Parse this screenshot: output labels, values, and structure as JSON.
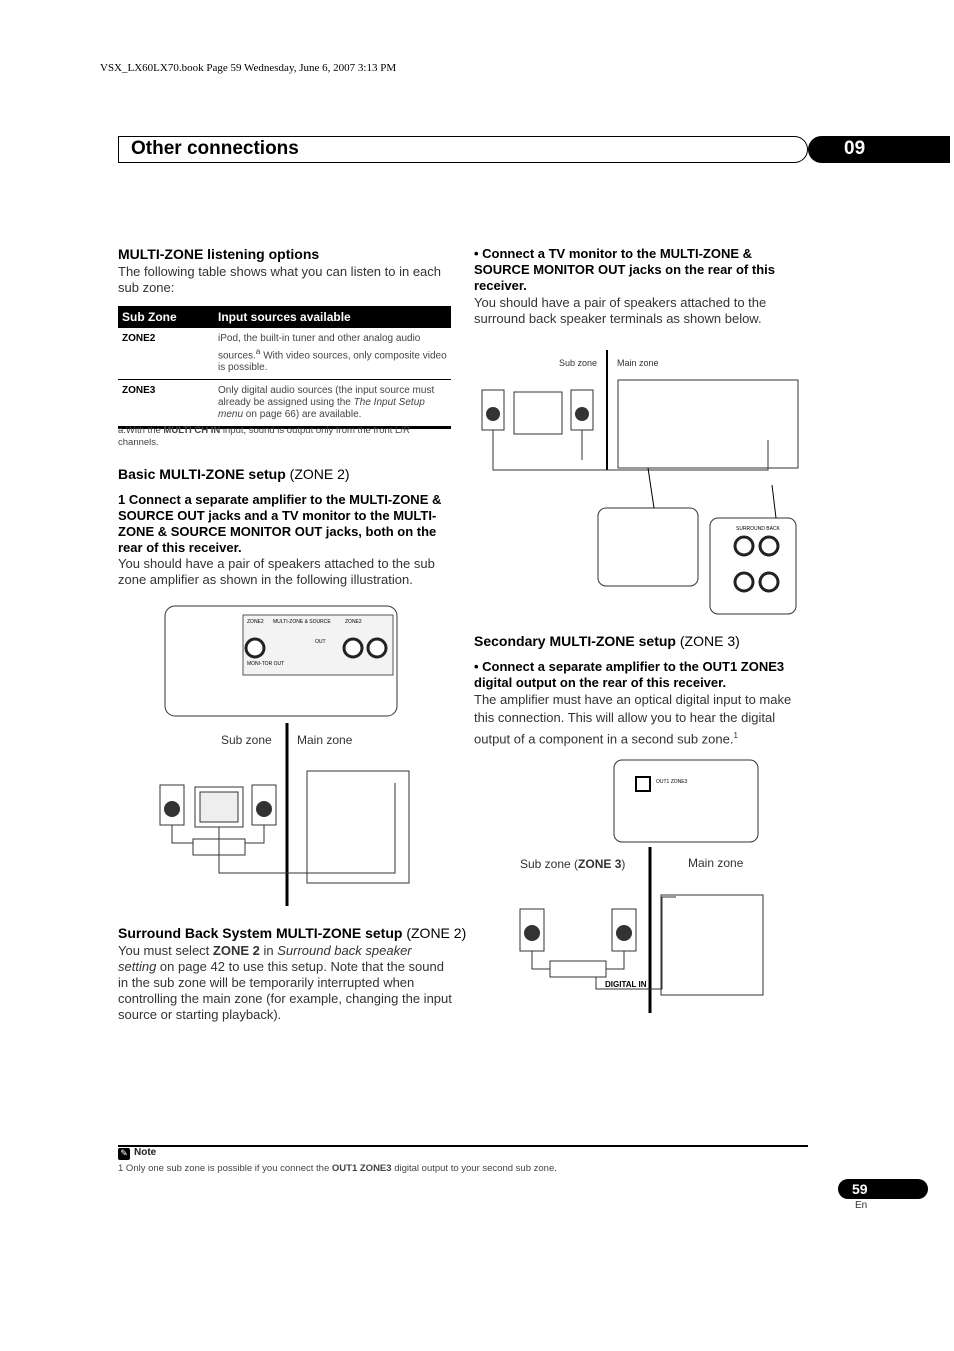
{
  "book_line": "VSX_LX60LX70.book  Page 59  Wednesday, June 6, 2007  3:13 PM",
  "header": {
    "title": "Other connections",
    "chapter": "09"
  },
  "left": {
    "h1": "MULTI-ZONE listening options",
    "intro": "The following table shows what you can listen to in each sub zone:",
    "table": {
      "headers": [
        "Sub Zone",
        "Input sources available"
      ],
      "rows": [
        {
          "zone": "ZONE2",
          "text": "iPod, the built-in tuner and other analog audio sources.",
          "sup": "a",
          "text2": " With video sources, only composite video is possible."
        },
        {
          "zone": "ZONE3",
          "text": "Only digital audio sources (the input source must already be assigned using the ",
          "italic": "The Input Setup menu",
          "text2": " on page 66) are available."
        }
      ]
    },
    "footnote": {
      "prefix": "a.With the ",
      "bold": "MULTI CH IN",
      "rest": " input, sound is output only from the front L/R channels."
    },
    "h2": "Basic MULTI-ZONE setup",
    "h2_paren": "(ZONE 2)",
    "step1": "1   Connect a separate amplifier to the MULTI-ZONE & SOURCE OUT jacks and a TV monitor to the MULTI-ZONE & SOURCE MONITOR OUT jacks, both on the rear of this receiver.",
    "step1_body": "You should have a pair of speakers attached to the sub zone amplifier as shown in the following illustration.",
    "diagram1": {
      "sub_zone": "Sub zone",
      "main_zone": "Main zone",
      "jack_labels": [
        "ZONE2",
        "MULTI-ZONE & SOURCE",
        "ZONE2",
        "OUT",
        "MONI-TOR OUT"
      ]
    },
    "h3": "Surround Back System MULTI-ZONE setup",
    "h3_paren": "(ZONE 2)",
    "sb_body": {
      "a": "You must select ",
      "b": "ZONE 2",
      "c": " in ",
      "d": "Surround back speaker setting",
      "e": " on page 42 to use this setup. Note that the sound in the sub zone will be temporarily interrupted when controlling the main zone (for example, changing the input source or starting playback)."
    }
  },
  "right": {
    "bullet1": "•   Connect a TV monitor to the MULTI-ZONE & SOURCE MONITOR OUT jacks on the rear of this receiver.",
    "bullet1_body": "You should have a pair of speakers attached to the surround back speaker terminals as shown below.",
    "diagram2": {
      "sub_zone": "Sub zone",
      "main_zone": "Main zone",
      "jack_label": "SURROUND BACK"
    },
    "h4": "Secondary MULTI-ZONE setup",
    "h4_paren": "(ZONE 3)",
    "bullet2": "•   Connect a separate amplifier to the OUT1 ZONE3 digital output on the rear of this receiver.",
    "bullet2_body": "The amplifier must have an optical digital input to make this connection. This will allow you to hear the digital output of a component in a second sub zone.",
    "bullet2_sup": "1",
    "diagram3": {
      "sub_zone": "Sub zone (",
      "sub_zone_bold": "ZONE 3",
      "sub_zone_end": ")",
      "main_zone": "Main zone",
      "digital_in": "DIGITAL IN",
      "jack_label": "OUT1 ZONE3"
    }
  },
  "note": {
    "title": "Note",
    "num": "1",
    "a": " Only one sub zone is possible if you connect the ",
    "bold": "OUT1 ZONE3",
    "b": " digital output to your second sub zone."
  },
  "footer": {
    "page": "59",
    "lang": "En"
  }
}
